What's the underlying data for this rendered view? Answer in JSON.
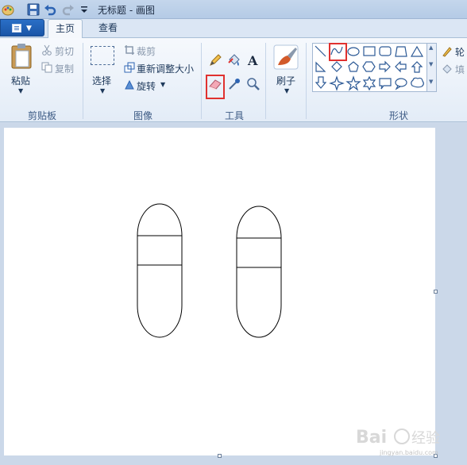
{
  "window": {
    "title": "无标题 - 画图"
  },
  "tabs": [
    {
      "label": "主页"
    },
    {
      "label": "查看"
    }
  ],
  "clipboard": {
    "paste": "粘贴",
    "cut": "剪切",
    "copy": "复制",
    "group": "剪贴板"
  },
  "image": {
    "select": "选择",
    "crop": "裁剪",
    "resize": "重新调整大小",
    "rotate": "旋转",
    "group": "图像"
  },
  "tools": {
    "group": "工具",
    "highlighted": "eraser"
  },
  "brushes": {
    "label": "刷子"
  },
  "shapes": {
    "group": "形状",
    "highlighted": "curve",
    "outline": "轮",
    "fill": "填"
  },
  "watermark": {
    "brand": "Bai",
    "suffix": "经验",
    "url": "jingyan.baidu.com"
  },
  "colors": {
    "highlight": "#e0312f",
    "accent": "#2a6fc6"
  }
}
